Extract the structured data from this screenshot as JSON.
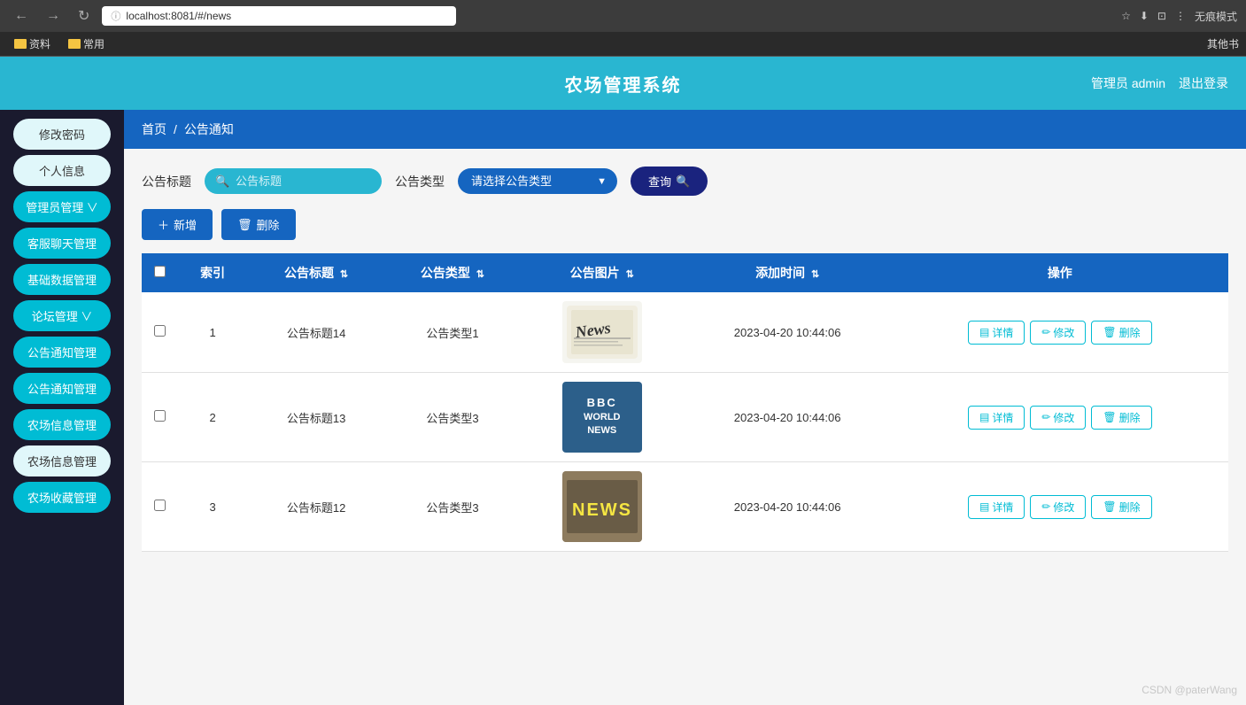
{
  "browser": {
    "url": "localhost:8081/#/news",
    "bookmark1": "资料",
    "bookmark2": "常用",
    "bookmark3": "其他书",
    "mode": "无痕模式"
  },
  "header": {
    "title": "农场管理系统",
    "user_label": "管理员 admin",
    "logout_label": "退出登录"
  },
  "breadcrumb": {
    "home": "首页",
    "separator": "/",
    "current": "公告通知"
  },
  "sidebar": {
    "items": [
      {
        "label": "修改密码",
        "style": "light"
      },
      {
        "label": "个人信息",
        "style": "light"
      },
      {
        "label": "管理员管理 ∨",
        "style": "cyan"
      },
      {
        "label": "客服聊天管理",
        "style": "cyan"
      },
      {
        "label": "基础数据管理",
        "style": "cyan"
      },
      {
        "label": "论坛管理 ∨",
        "style": "cyan"
      },
      {
        "label": "公告通知管理",
        "style": "cyan",
        "active": true
      },
      {
        "label": "公告通知管理",
        "style": "cyan"
      },
      {
        "label": "农场信息管理",
        "style": "cyan"
      },
      {
        "label": "农场信息管理",
        "style": "light"
      },
      {
        "label": "农场收藏管理",
        "style": "cyan"
      }
    ]
  },
  "search": {
    "label1": "公告标题",
    "input_placeholder": "公告标题",
    "label2": "公告类型",
    "dropdown_placeholder": "请选择公告类型",
    "search_btn": "查询"
  },
  "actions": {
    "add": "+ 新增",
    "delete": "删除"
  },
  "table": {
    "headers": [
      "",
      "索引",
      "公告标题",
      "公告类型",
      "公告图片",
      "添加时间",
      "操作"
    ],
    "rows": [
      {
        "index": 1,
        "title": "公告标题14",
        "type": "公告类型1",
        "img_type": "news1",
        "time": "2023-04-20 10:44:06"
      },
      {
        "index": 2,
        "title": "公告标题13",
        "type": "公告类型3",
        "img_type": "bbc",
        "time": "2023-04-20 10:44:06"
      },
      {
        "index": 3,
        "title": "公告标题12",
        "type": "公告类型3",
        "img_type": "news3",
        "time": "2023-04-20 10:44:06"
      }
    ],
    "btn_detail": "详情",
    "btn_edit": "修改",
    "btn_delete": "删除"
  },
  "watermark": "CSDN @paterWang"
}
